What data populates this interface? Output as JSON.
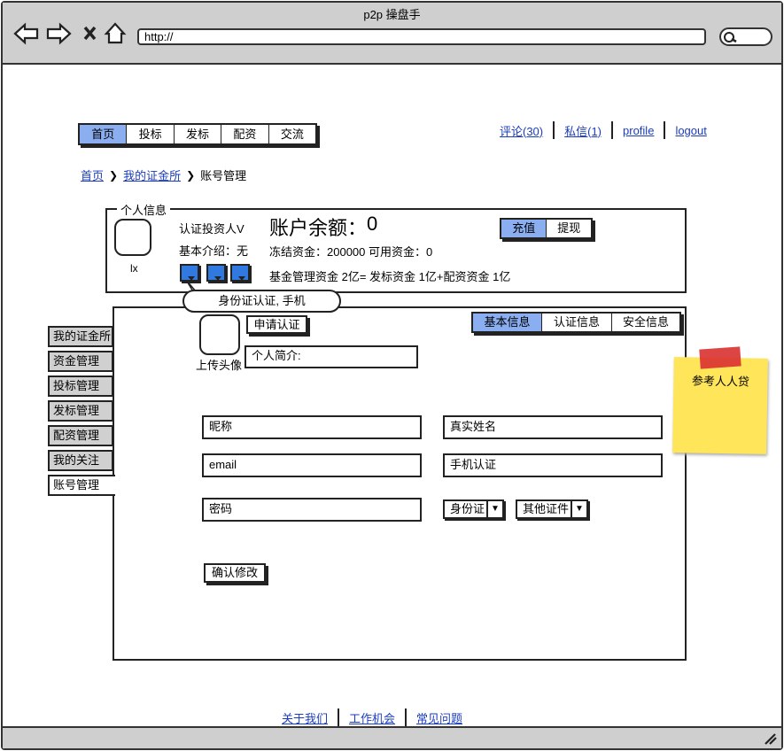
{
  "window": {
    "title": "p2p 操盘手",
    "url": "http://"
  },
  "nav": {
    "tabs": [
      "首页",
      "投标",
      "发标",
      "配资",
      "交流"
    ],
    "right_links": [
      "评论(30)",
      "私信(1)",
      "profile",
      "logout"
    ]
  },
  "breadcrumb": {
    "home": "首页",
    "parent": "我的证金所",
    "current": "账号管理"
  },
  "profile": {
    "legend": "个人信息",
    "username": "lx",
    "verified": "认证投资人V",
    "intro": "基本介绍：无",
    "balance_label": "账户余额：",
    "balance_value": "0",
    "frozen": "冻结资金：200000 可用资金：0",
    "fund_line": "基金管理资金 2亿= 发标资金 1亿+配资资金 1亿",
    "recharge": "充值",
    "withdraw": "提现",
    "tooltip": "身份证认证, 手机"
  },
  "sidebar": [
    "我的证金所",
    "资金管理",
    "投标管理",
    "发标管理",
    "配资管理",
    "我的关注",
    "账号管理"
  ],
  "main": {
    "apply_cert": "申请认证",
    "upload_avatar": "上传头像",
    "bio_placeholder": "个人简介:",
    "tabs": [
      "基本信息",
      "认证信息",
      "安全信息"
    ],
    "fields": {
      "nickname": "昵称",
      "realname": "真实姓名",
      "email": "email",
      "phone": "手机认证",
      "password": "密码"
    },
    "id_select": "身份证",
    "other_select": "其他证件",
    "confirm": "确认修改"
  },
  "sticky_note": "参考人人贷",
  "footer": [
    "关于我们",
    "工作机会",
    "常见问题"
  ],
  "colors": {
    "active_tab": "#8aaef0",
    "icon_blue": "#2f79e0",
    "link": "#1a3cbf",
    "sticky": "#ffe55a",
    "tape": "#d93030"
  }
}
